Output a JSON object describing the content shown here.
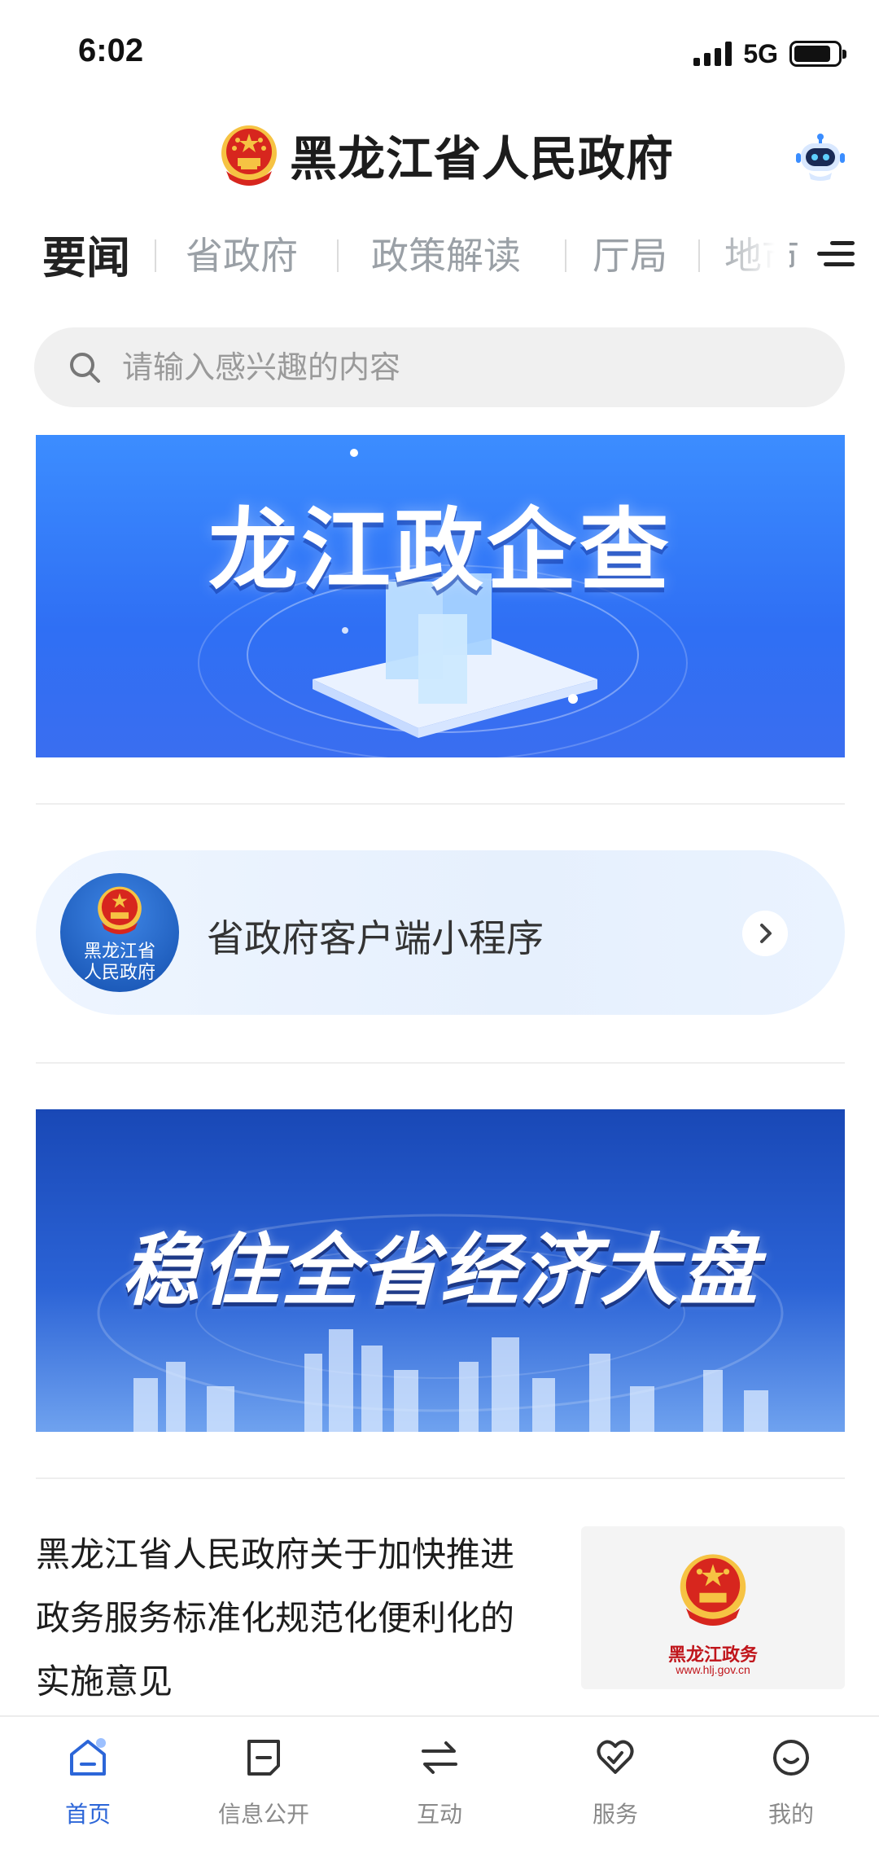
{
  "status_bar": {
    "time": "6:02",
    "network": "5G"
  },
  "header": {
    "title": "黑龙江省人民政府"
  },
  "tabs": [
    {
      "label": "要闻",
      "active": true
    },
    {
      "label": "省政府",
      "active": false
    },
    {
      "label": "政策解读",
      "active": false
    },
    {
      "label": "厅局",
      "active": false
    },
    {
      "label": "地市",
      "active": false
    }
  ],
  "search": {
    "placeholder": "请输入感兴趣的内容"
  },
  "banner1": {
    "title": "龙江政企查"
  },
  "mini_program": {
    "logo_text_line1": "黑龙江省",
    "logo_text_line2": "人民政府",
    "title": "省政府客户端小程序"
  },
  "banner2": {
    "title": "稳住全省经济大盘"
  },
  "news": [
    {
      "title": "黑龙江省人民政府关于加快推进政务服务标准化规范化便利化的实施意见",
      "thumb_caption": "黑龙江政务",
      "thumb_url": "www.hlj.gov.cn"
    }
  ],
  "bottom_nav": [
    {
      "label": "首页",
      "icon": "home-icon",
      "active": true
    },
    {
      "label": "信息公开",
      "icon": "info-public-icon",
      "active": false
    },
    {
      "label": "互动",
      "icon": "interact-icon",
      "active": false
    },
    {
      "label": "服务",
      "icon": "service-icon",
      "active": false
    },
    {
      "label": "我的",
      "icon": "profile-icon",
      "active": false
    }
  ],
  "colors": {
    "accent": "#2c66d8",
    "emblem_red": "#d7261e",
    "emblem_gold": "#f6c343"
  }
}
